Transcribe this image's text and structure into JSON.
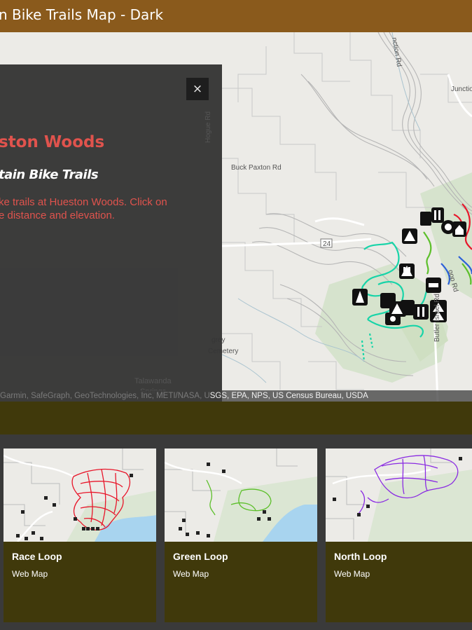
{
  "header": {
    "title": "n Bike Trails Map - Dark"
  },
  "panel": {
    "close_label": "×",
    "title": "ston Woods",
    "subtitle": "tain Bike Trails",
    "description_line1": "ke trails at Hueston Woods. Click on",
    "description_line2": "e distance and elevation."
  },
  "map": {
    "labels": {
      "road_junction": "nction Rd",
      "junction": "Junctio",
      "buck_paxton": "Buck Paxton Rd",
      "route": "24",
      "talawanda": "Talawanda",
      "springs": "Springs",
      "cemetery1": "grey",
      "cemetery2": "Cemetery",
      "butler_israel": "Butler Israel Rd",
      "loop_rd": "oop Rd",
      "vertical_road": "Hogue Rd"
    },
    "attribution_faint": "Garmin, SafeGraph, GeoTechnologies, Inc, METI/NASA, U",
    "attribution": "SGS, EPA, NPS, US Census Bureau, USDA",
    "colors": {
      "race": "#e8162a",
      "green": "#5cbf2a",
      "north": "#8a2be2",
      "teal": "#17d4a8",
      "blue": "#2b5fd9"
    }
  },
  "gallery": {
    "cards": [
      {
        "title": "Race Loop",
        "type": "Web Map"
      },
      {
        "title": "Green Loop",
        "type": "Web Map"
      },
      {
        "title": "North Loop",
        "type": "Web Map"
      }
    ]
  }
}
